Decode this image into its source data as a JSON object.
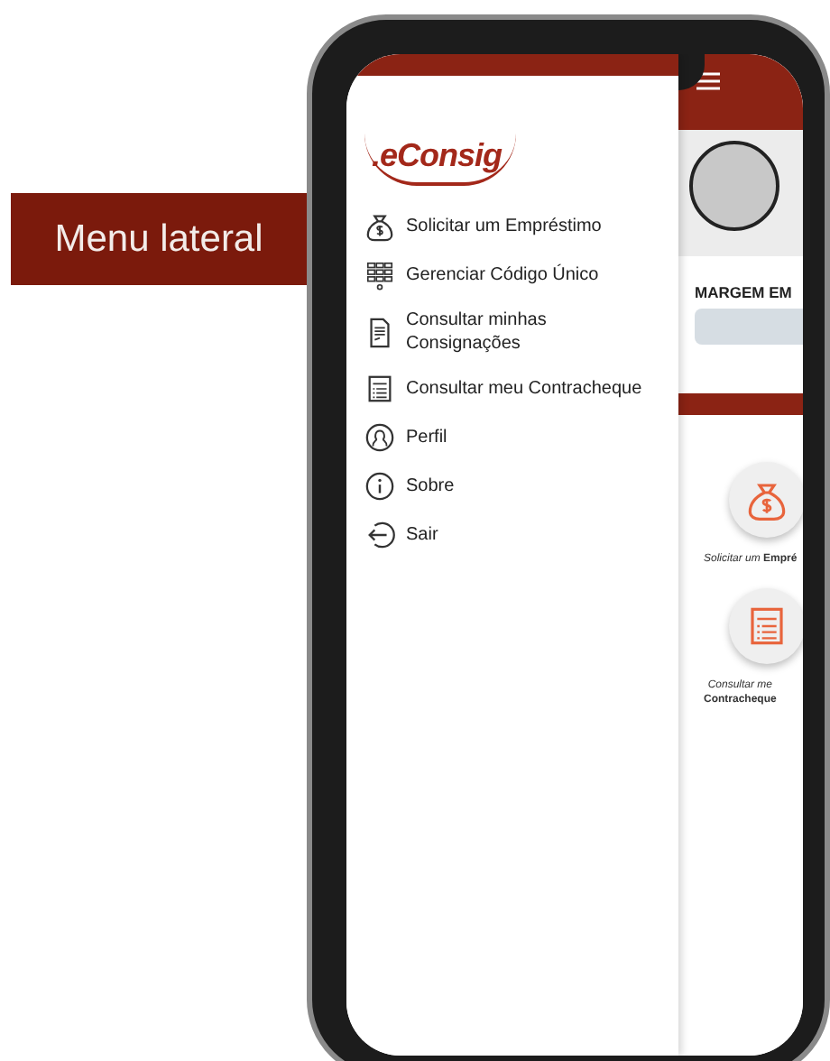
{
  "callout": {
    "label": "Menu lateral"
  },
  "drawer": {
    "logo": ".eConsig",
    "items": [
      {
        "kind": "loan",
        "label": "Solicitar um Empréstimo"
      },
      {
        "kind": "code",
        "label": "Gerenciar Código Único"
      },
      {
        "kind": "consignments",
        "label": "Consultar minhas Consignações"
      },
      {
        "kind": "payslip",
        "label": "Consultar meu Contracheque"
      },
      {
        "kind": "profile",
        "label": "Perfil"
      },
      {
        "kind": "about",
        "label": "Sobre"
      },
      {
        "kind": "exit",
        "label": "Sair"
      }
    ]
  },
  "app": {
    "margin_label": "MARGEM EM",
    "actions": [
      {
        "kind": "loan",
        "lines": [
          "*Solicitar um* **Empré**"
        ]
      },
      {
        "kind": "payslip",
        "lines": [
          "*Consultar me*",
          "**Contracheque**"
        ]
      }
    ]
  }
}
